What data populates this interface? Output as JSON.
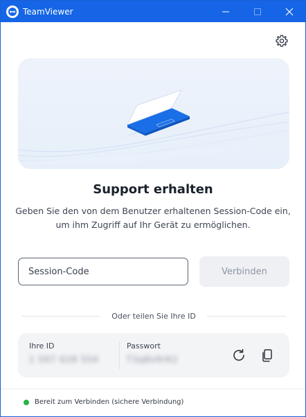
{
  "titlebar": {
    "title": "TeamViewer",
    "logo_icon": "teamviewer-logo-icon",
    "color": "#1565e6"
  },
  "settings_icon": "gear-icon",
  "main": {
    "heading": "Support erhalten",
    "description": "Geben Sie den von dem Benutzer erhaltenen Session-Code ein, um ihm Zugriff auf Ihr Gerät zu ermöglichen.",
    "session_input": {
      "value": "",
      "placeholder": "Session-Code"
    },
    "connect_label": "Verbinden",
    "share_divider": "Oder teilen Sie Ihre ID"
  },
  "id_card": {
    "id_label": "Ihre ID",
    "id_value": "1 507 628 554",
    "password_label": "Passwort",
    "password_value": "T3q8x9rK2",
    "refresh_icon": "refresh-icon",
    "copy_icon": "copy-icon"
  },
  "status": {
    "text": "Bereit zum Verbinden (sichere Verbindung)",
    "color": "#27b24a"
  }
}
